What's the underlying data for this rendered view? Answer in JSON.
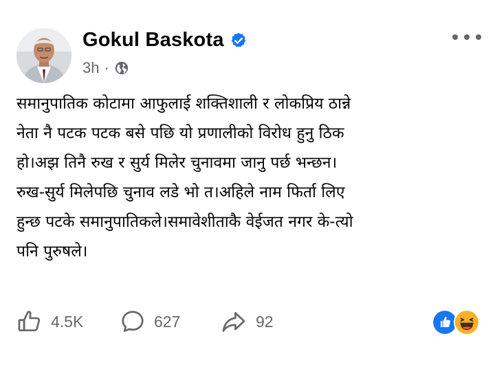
{
  "post": {
    "author": "Gokul Baskota",
    "verified": true,
    "time": "3h",
    "separator": "·",
    "audience_icon": "globe-icon",
    "more_icon": "more-options-icon",
    "text_lines": [
      "समानुपातिक कोटामा आफुलाई शक्तिशाली र लोकप्रिय ठान्ने",
      "नेता नै पटक पटक बसे पछि यो प्रणालीको विरोध हुनु ठिक",
      "हो।अझ तिनै रुख र सुर्य मिलेर चुनावमा जानु पर्छ भन्छन।",
      "रुख-सुर्य मिलेपछि चुनाव लडे भो त।अहिले नाम फिर्ता लिए",
      "हुन्छ पटके समानुपातिकले।समावेशीताकै वेईजत नगर के-त्यो",
      "पनि पुरुषले।"
    ]
  },
  "actions": {
    "likes": "4.5K",
    "comments": "627",
    "shares": "92"
  },
  "reactions": [
    "like-reaction-icon",
    "haha-reaction-icon"
  ],
  "colors": {
    "text": "#050505",
    "secondary": "#65676b",
    "verified_blue": "#1877f2",
    "haha_yellow": "#f7b125"
  }
}
